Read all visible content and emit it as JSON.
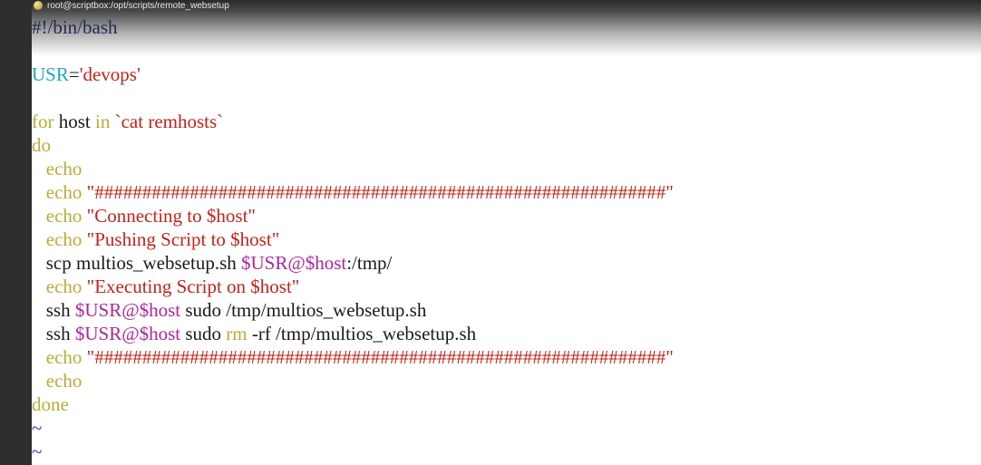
{
  "window": {
    "title": "root@scriptbox:/opt/scripts/remote_websetup"
  },
  "code": {
    "shebang": "#!/bin/bash",
    "usr_var": "USR",
    "usr_eq": "=",
    "usr_value": "'devops'",
    "for_kw": "for",
    "for_host": " host ",
    "in_kw": "in",
    "backtick_cmd": " `cat remhosts`",
    "do_kw": "do",
    "indent": "   ",
    "echo_kw": "echo",
    "hash_string": "\"############################################################\"",
    "connecting_str": "\"Connecting to ",
    "host_var": "$host",
    "quote_close": "\"",
    "pushing_str": "\"Pushing Script to ",
    "scp_cmd": "scp multios_websetup.sh ",
    "usr_ref": "$USR",
    "at": "@",
    "scp_dest": ":/tmp/",
    "executing_str": "\"Executing Script on ",
    "ssh_cmd": "ssh ",
    "sudo_setup": " sudo /tmp/multios_websetup.sh",
    "sudo": " sudo ",
    "rm_kw": "rm",
    "rm_args": " -rf /tmp/multios_websetup.sh",
    "done_kw": "done",
    "tilde": "~"
  },
  "colors": {
    "comment": "#1e2a7a",
    "variable": "#1aa9b3",
    "string": "#c0231b",
    "keyword": "#b7ad3a",
    "dollar": "#b0249a",
    "tilde": "#2d2db0"
  }
}
